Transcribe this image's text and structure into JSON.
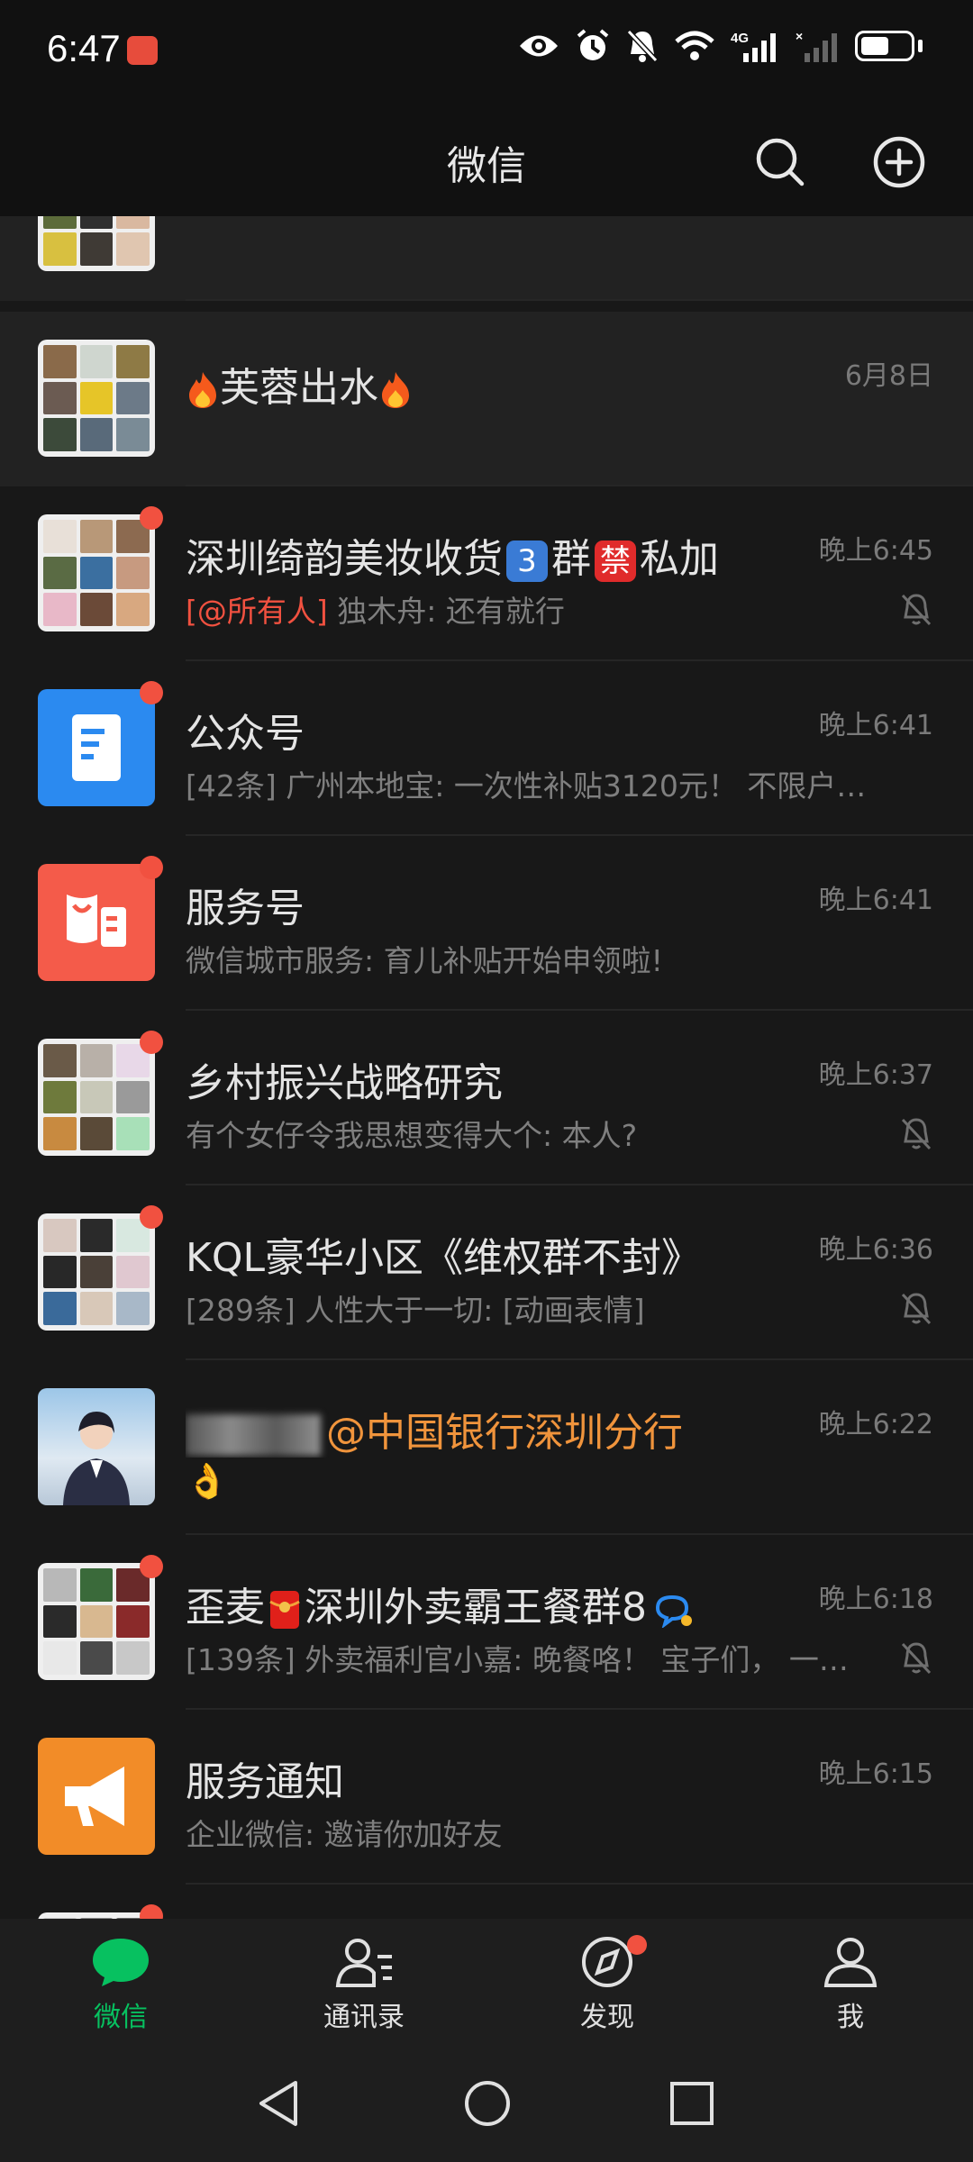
{
  "status": {
    "time": "6:47",
    "network": "4G"
  },
  "header": {
    "title": "微信"
  },
  "chats": [
    {
      "name": "",
      "time": "",
      "preview": "",
      "pinned": true
    },
    {
      "name": "芙蓉出水",
      "time": "6月8日",
      "preview": "",
      "pinned": true
    },
    {
      "name_pre": "深圳绮韵美妆收货",
      "name_badge": "3",
      "name_mid": "群",
      "name_badge2": "禁",
      "name_post": "私加",
      "time": "晚上6:45",
      "mention": "[@所有人]",
      "preview": "独木舟: 还有就行",
      "unread": true,
      "muted": true
    },
    {
      "name": "公众号",
      "time": "晚上6:41",
      "preview": "[42条] 广州本地宝: 一次性补贴3120元！ 不限户…",
      "unread": true
    },
    {
      "name": "服务号",
      "time": "晚上6:41",
      "preview": "微信城市服务: 育儿补贴开始申领啦!",
      "unread": true
    },
    {
      "name": "乡村振兴战略研究",
      "time": "晚上6:37",
      "preview": "有个女仔令我思想变得大个: 本人?",
      "unread": true,
      "muted": true
    },
    {
      "name": "KQL豪华小区《维权群不封》",
      "time": "晚上6:36",
      "preview": "[289条] 人性大于一切: [动画表情]",
      "unread": true,
      "muted": true
    },
    {
      "name": "@中国银行深圳分行",
      "time": "晚上6:22",
      "preview": "👌"
    },
    {
      "name": "歪麦",
      "name_post": "深圳外卖霸王餐群8",
      "time": "晚上6:18",
      "preview": "[139条] 外卖福利官小嘉: 晚餐咯！ 宝子们， 一…",
      "unread": true,
      "muted": true
    },
    {
      "name": "服务通知",
      "time": "晚上6:15",
      "preview": "企业微信:  邀请你加好友"
    }
  ],
  "tabs": [
    {
      "label": "微信",
      "active": true
    },
    {
      "label": "通讯录"
    },
    {
      "label": "发现",
      "dot": true
    },
    {
      "label": "我"
    }
  ],
  "colors": {
    "accent": "#07c160",
    "unread_dot": "#f15140",
    "mention": "#f15140",
    "at_name": "#f0943c",
    "background": "#181818"
  },
  "icons": [
    "search-icon",
    "add-icon",
    "mute-bell-icon",
    "chat-bubble-icon",
    "contacts-icon",
    "compass-icon",
    "profile-icon",
    "back-nav-icon",
    "home-nav-icon",
    "recents-nav-icon"
  ]
}
